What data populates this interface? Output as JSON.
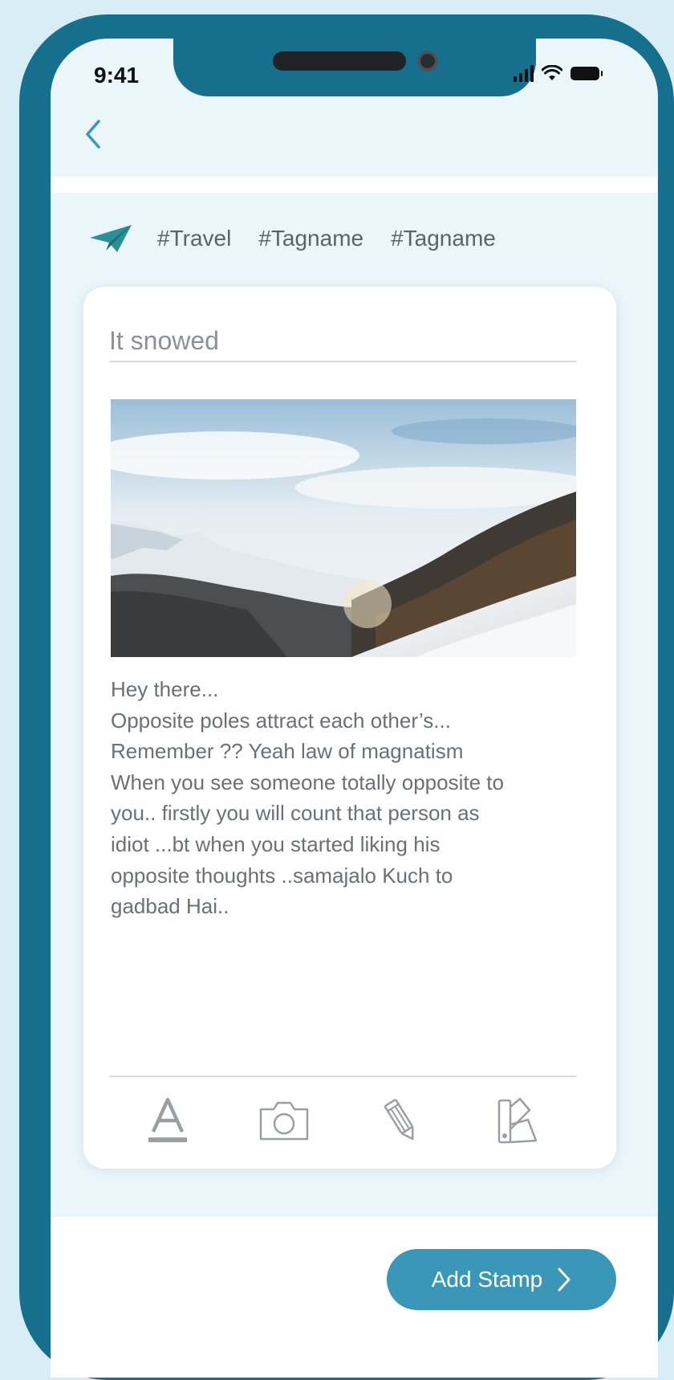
{
  "status": {
    "time": "9:41"
  },
  "nav": {
    "back_icon": "chevron-left-icon"
  },
  "tags": [
    "#Travel",
    "#Tagname",
    "#Tagname"
  ],
  "post": {
    "title_value": "It snowed",
    "body": "Hey there...\nOpposite poles attract each other’s...\nRemember ?? Yeah law of magnatism\nWhen you see someone totally opposite to\nyou.. firstly you will count that person as\nidiot ...bt when you started liking his\nopposite thoughts ..samajalo Kuch to\ngadbad Hai.."
  },
  "toolbar": {
    "icons": [
      "text-format-icon",
      "camera-icon",
      "pencil-icon",
      "color-swatch-icon"
    ]
  },
  "actions": {
    "add_stamp_label": "Add Stamp"
  },
  "colors": {
    "accent": "#3a97b7",
    "frame": "#176f8e",
    "screen": "#eaf6fa",
    "tag_icon": "#2a8f98"
  }
}
